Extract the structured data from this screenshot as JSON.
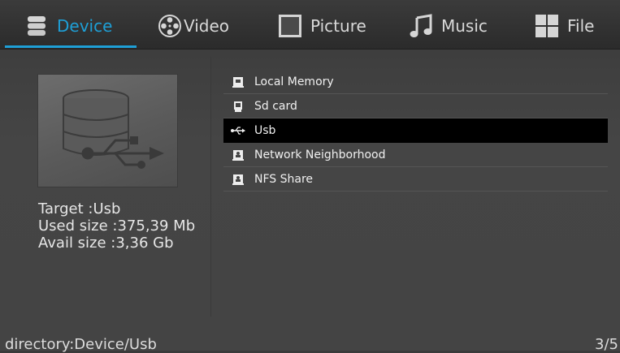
{
  "tabs": [
    {
      "label": "Device",
      "icon": "database-icon",
      "active": true
    },
    {
      "label": "Video",
      "icon": "film-reel-icon",
      "active": false
    },
    {
      "label": "Picture",
      "icon": "picture-frame-icon",
      "active": false
    },
    {
      "label": "Music",
      "icon": "music-note-icon",
      "active": false
    },
    {
      "label": "File",
      "icon": "grid-icon",
      "active": false
    }
  ],
  "accent_color": "#1e9fd6",
  "device_info": {
    "target": "Target :Usb",
    "used": "Used size :375,39 Mb",
    "avail": "Avail size :3,36 Gb"
  },
  "devices": [
    {
      "label": "Local Memory",
      "icon": "memory-icon",
      "selected": false
    },
    {
      "label": "Sd card",
      "icon": "sd-card-icon",
      "selected": false
    },
    {
      "label": "Usb",
      "icon": "usb-icon",
      "selected": true
    },
    {
      "label": "Network Neighborhood",
      "icon": "network-icon",
      "selected": false
    },
    {
      "label": "NFS Share",
      "icon": "nfs-icon",
      "selected": false
    }
  ],
  "status": {
    "path": "directory:Device/Usb",
    "page": "3/5"
  }
}
